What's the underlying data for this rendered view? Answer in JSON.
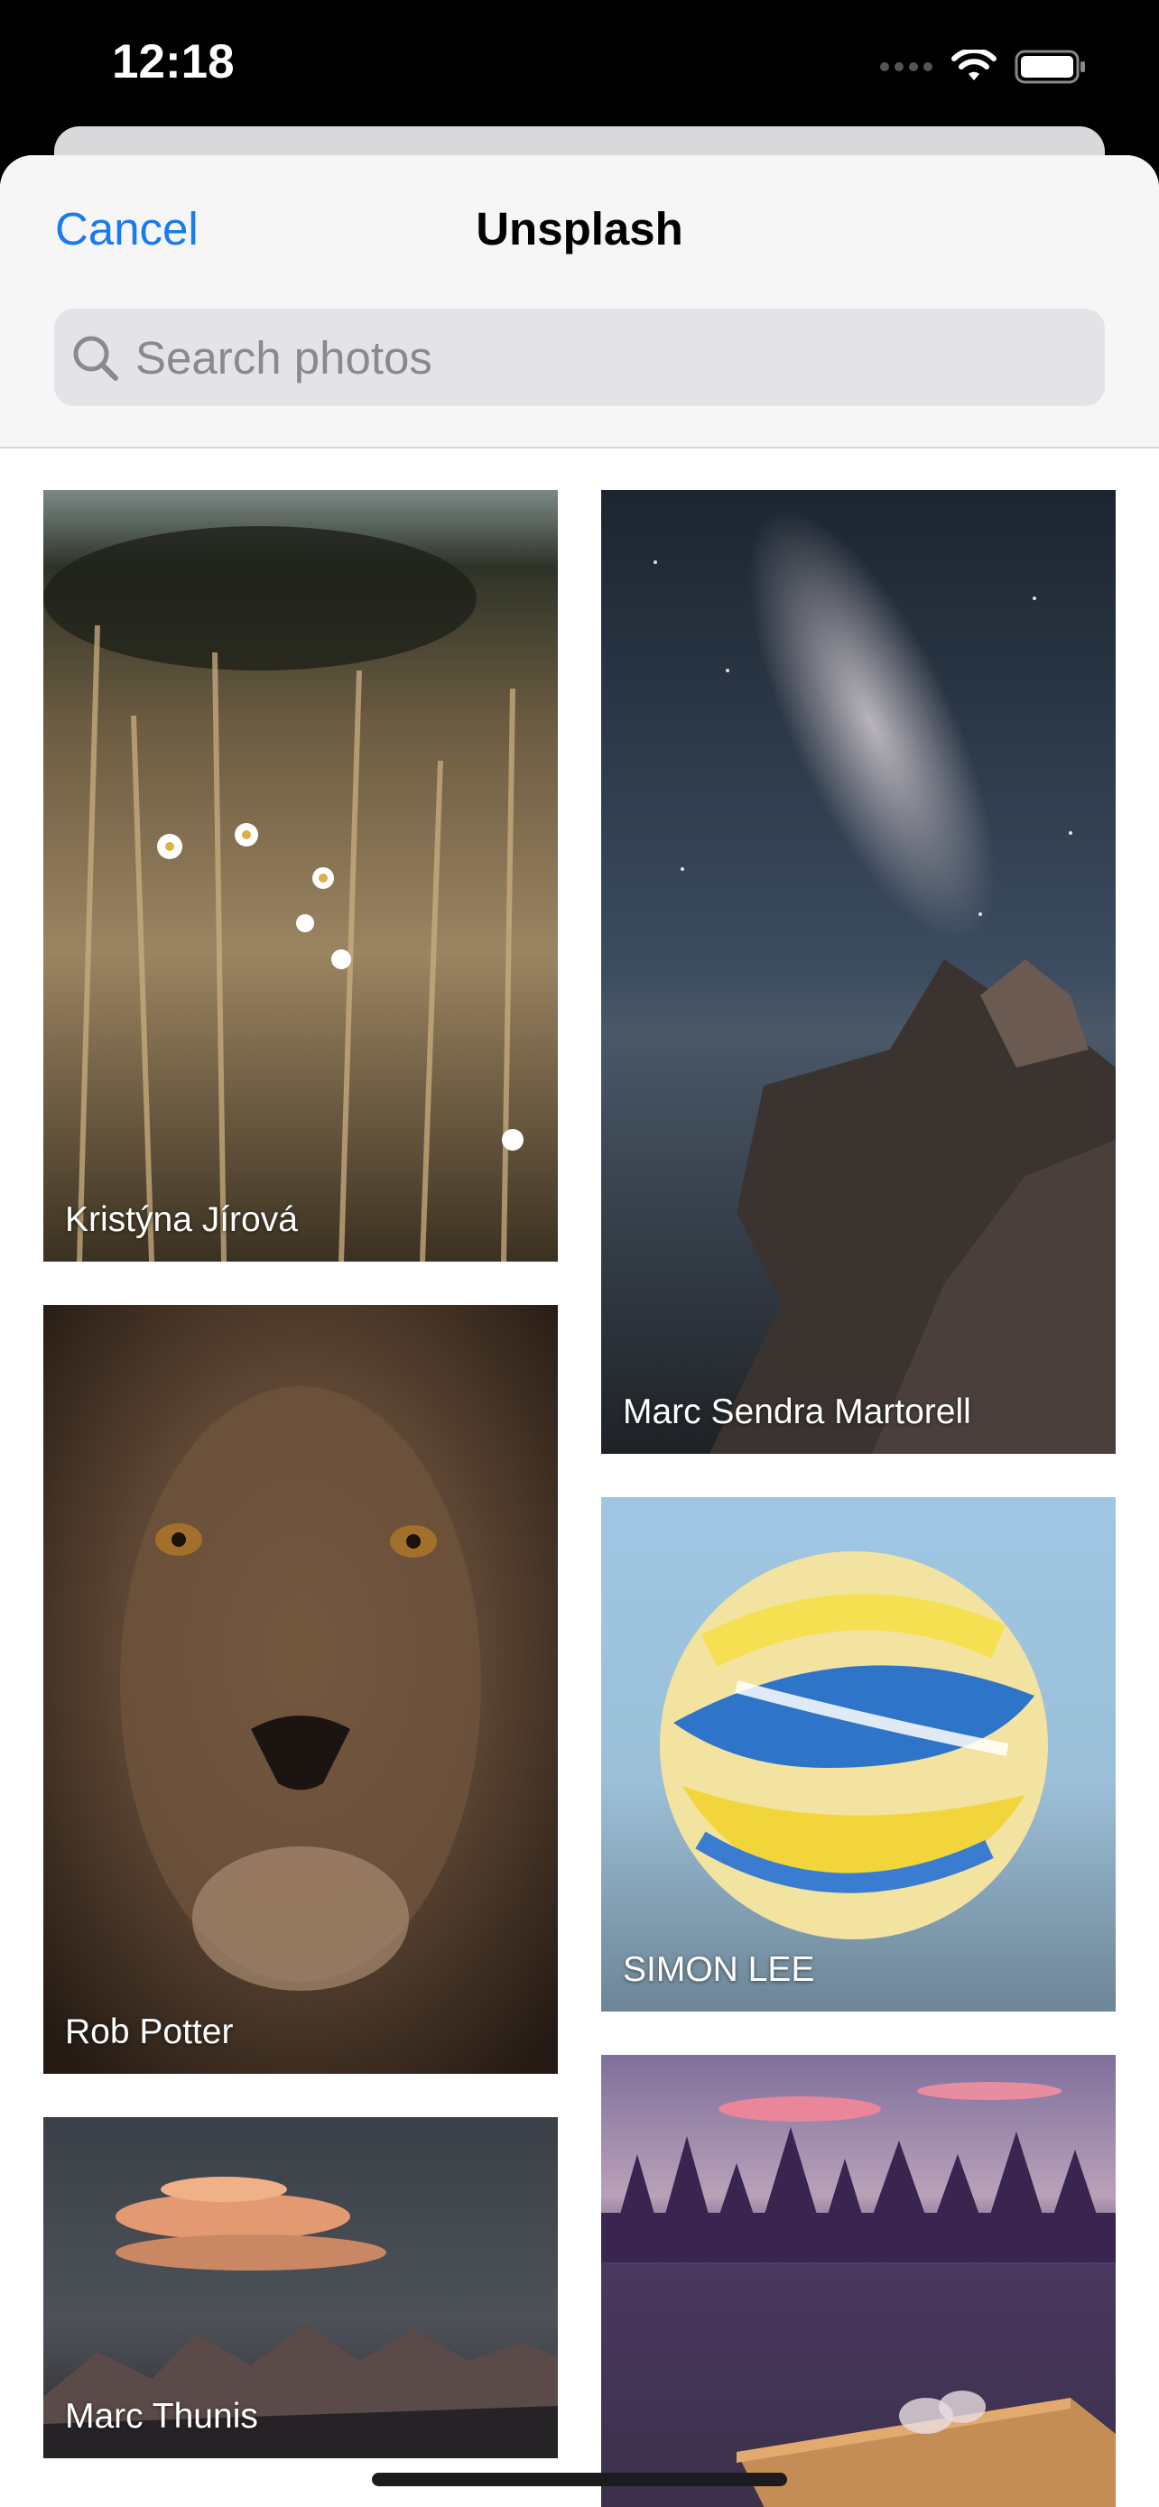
{
  "status_bar": {
    "time": "12:18",
    "icons": [
      "cellular-signal-icon",
      "wifi-icon",
      "battery-icon"
    ]
  },
  "navbar": {
    "cancel_label": "Cancel",
    "title": "Unsplash",
    "accent_color": "#1a7bef"
  },
  "search": {
    "placeholder": "Search photos",
    "value": "",
    "icon": "search-icon"
  },
  "photos": [
    {
      "credit": "Kristýna Jírová",
      "subject": "wheat field with daisies"
    },
    {
      "credit": "Marc Sendra Martorell",
      "subject": "milky way over rocky coast"
    },
    {
      "credit": "Rob Potter",
      "subject": "lion face"
    },
    {
      "credit": "SIMON LEE",
      "subject": "paint swirl sphere"
    },
    {
      "credit": "Marc Thunis",
      "subject": "lenticular cloud over mountains"
    },
    {
      "credit": "",
      "subject": "forest lake with dock"
    }
  ]
}
